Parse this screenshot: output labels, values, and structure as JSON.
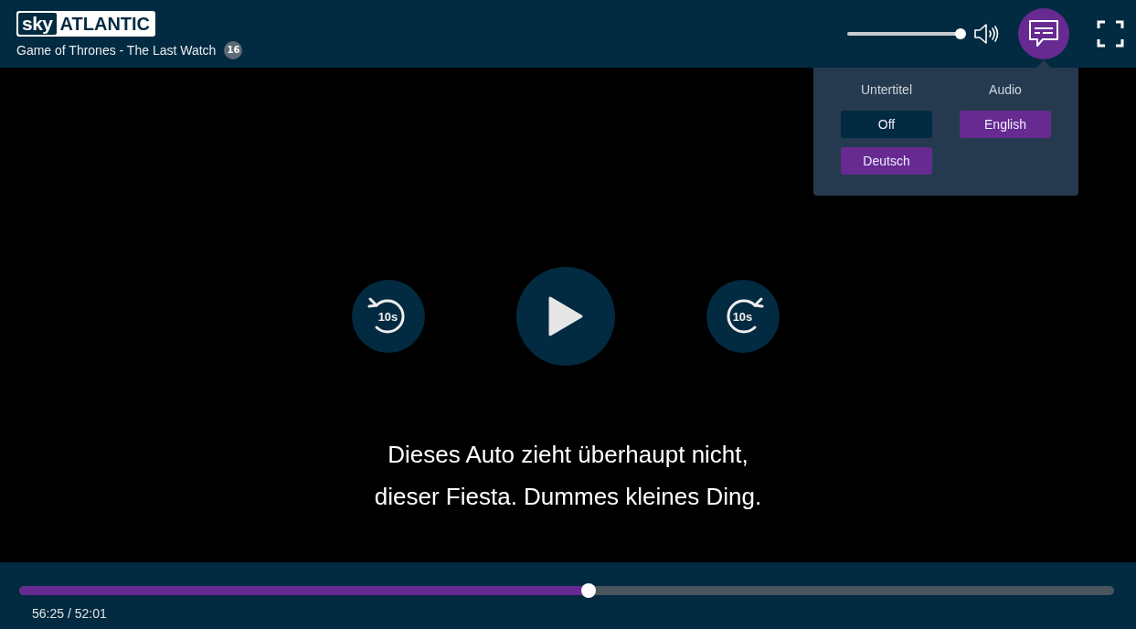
{
  "header": {
    "logo": {
      "brand": "sky",
      "channel": "ATLANTIC"
    },
    "title": "Game of Thrones - The Last Watch",
    "age_rating": "16"
  },
  "volume": {
    "level": 1.0
  },
  "subtitles_button": {
    "active": true
  },
  "menu": {
    "columns": [
      {
        "heading": "Untertitel",
        "options": [
          {
            "label": "Off",
            "selected": false
          },
          {
            "label": "Deutsch",
            "selected": true
          }
        ]
      },
      {
        "heading": "Audio",
        "options": [
          {
            "label": "English",
            "selected": true
          }
        ]
      }
    ]
  },
  "controls": {
    "rewind": "10s",
    "forward": "10s"
  },
  "subtitle_lines": [
    "Dieses Auto zieht überhaupt nicht,",
    "dieser Fiesta. Dummes kleines Ding."
  ],
  "progress": {
    "level": 0.52,
    "time": "56:25 / 52:01"
  }
}
